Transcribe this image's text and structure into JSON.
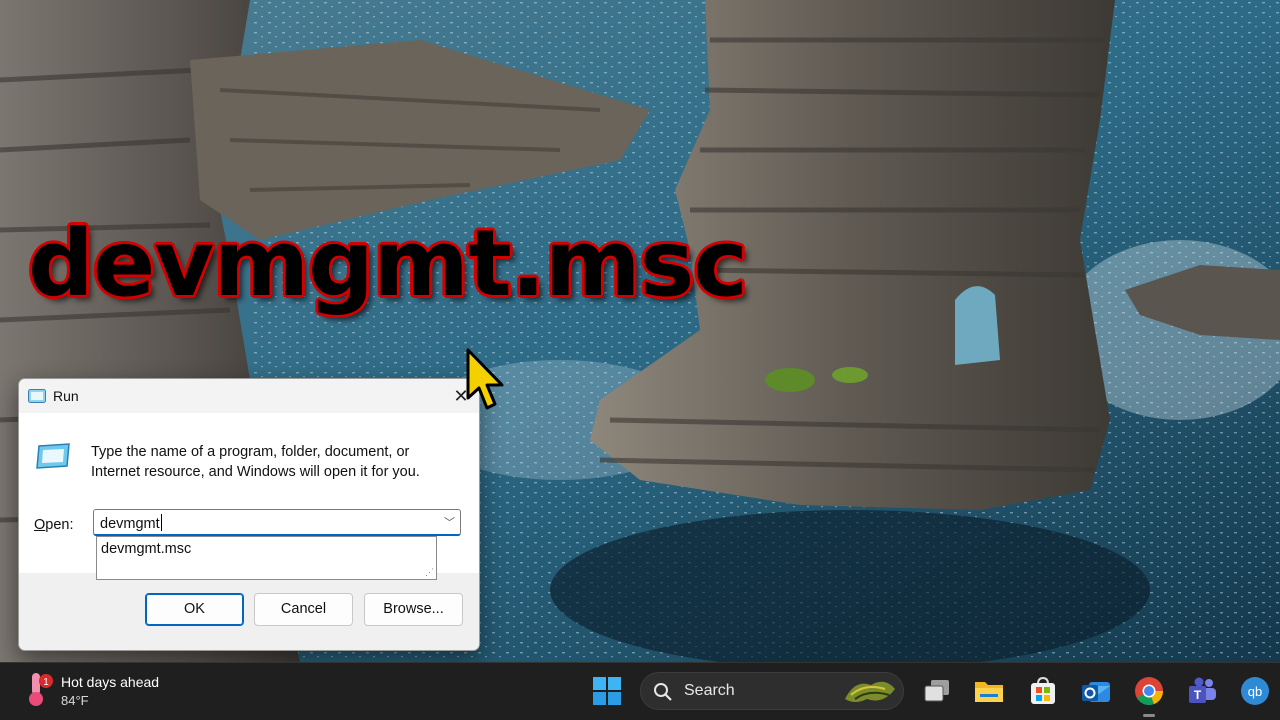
{
  "overlay": {
    "caption": "devmgmt.msc"
  },
  "run_dialog": {
    "title": "Run",
    "description": "Type the name of a program, folder, document, or Internet resource, and Windows will open it for you.",
    "open_label_prefix": "",
    "open_label_accel": "O",
    "open_label_rest": "pen:",
    "input_value": "devmgmt",
    "autocomplete_suggestion": "devmgmt.msc",
    "buttons": {
      "ok": "OK",
      "cancel": "Cancel",
      "browse": "Browse..."
    }
  },
  "taskbar": {
    "weather": {
      "title": "Hot days ahead",
      "temp": "84°F",
      "badge": "1"
    },
    "search_label": "Search",
    "apps": [
      "start-icon",
      "search-icon",
      "task-view-icon",
      "file-explorer-icon",
      "microsoft-store-icon",
      "outlook-icon",
      "chrome-icon",
      "teams-icon",
      "qbittorrent-icon"
    ]
  },
  "colors": {
    "accent": "#0067c0",
    "caption_outline": "#d40000",
    "cursor": "#f5d000",
    "taskbar": "#1f1f1f"
  }
}
